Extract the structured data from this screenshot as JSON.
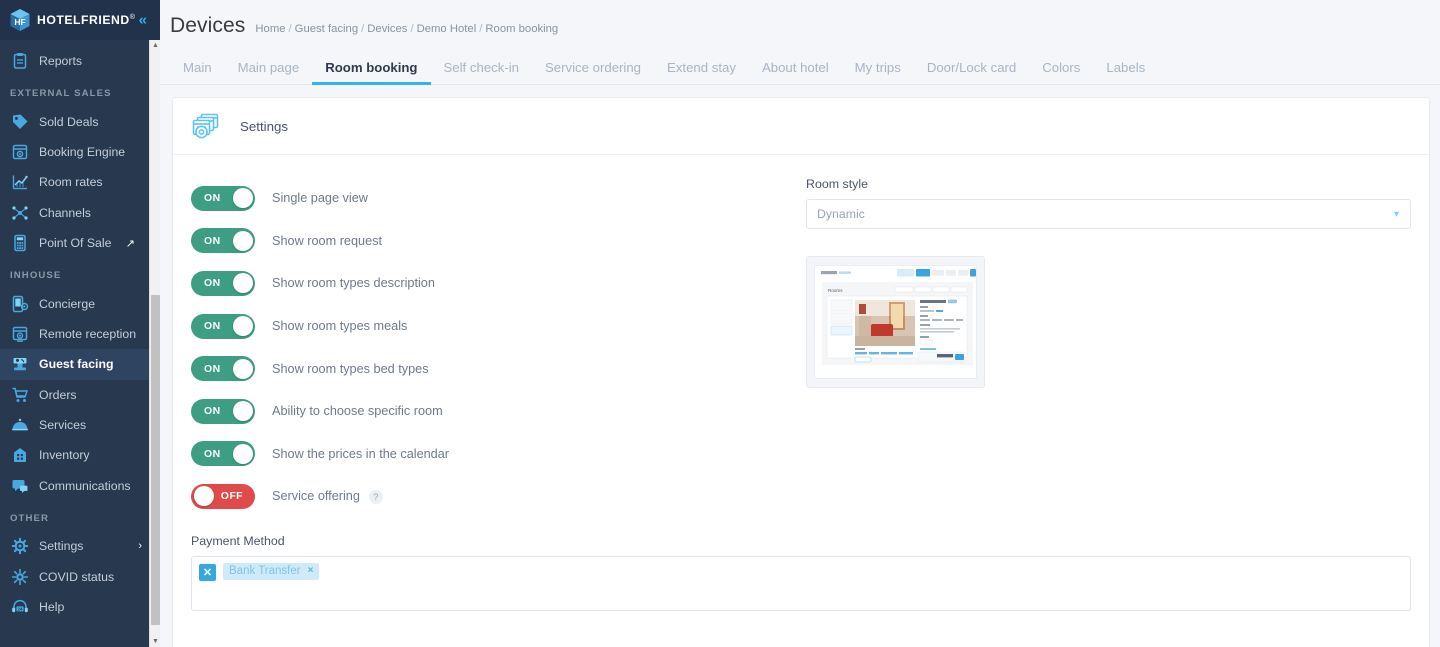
{
  "brand": {
    "logo_text": "HOTELFRIEND",
    "logo_mark": "cube-hf-logo",
    "registered_mark": "®",
    "collapse_icon": "chevron-double-left-icon"
  },
  "sidebar": {
    "items": [
      {
        "type": "item",
        "label": "Reports",
        "icon": "clipboard-icon",
        "active": false
      },
      {
        "type": "group",
        "label": "EXTERNAL SALES"
      },
      {
        "type": "item",
        "label": "Sold Deals",
        "icon": "tag-icon",
        "active": false
      },
      {
        "type": "item",
        "label": "Booking Engine",
        "icon": "window-gear-icon",
        "active": false
      },
      {
        "type": "item",
        "label": "Room rates",
        "icon": "chart-line-icon",
        "active": false
      },
      {
        "type": "item",
        "label": "Channels",
        "icon": "network-nodes-icon",
        "active": false
      },
      {
        "type": "item",
        "label": "Point Of Sale",
        "icon": "calculator-icon",
        "active": false,
        "trailing_icon": "external-link-icon"
      },
      {
        "type": "group",
        "label": "INHOUSE"
      },
      {
        "type": "item",
        "label": "Concierge",
        "icon": "phone-gear-icon",
        "active": false
      },
      {
        "type": "item",
        "label": "Remote reception",
        "icon": "monitor-gear-icon",
        "active": false
      },
      {
        "type": "item",
        "label": "Guest facing",
        "icon": "guest-podium-icon",
        "active": true
      },
      {
        "type": "item",
        "label": "Orders",
        "icon": "shopping-cart-icon",
        "active": false
      },
      {
        "type": "item",
        "label": "Services",
        "icon": "cloche-dome-icon",
        "active": false
      },
      {
        "type": "item",
        "label": "Inventory",
        "icon": "building-icon",
        "active": false
      },
      {
        "type": "item",
        "label": "Communications",
        "icon": "chat-bubbles-icon",
        "active": false
      },
      {
        "type": "group",
        "label": "OTHER"
      },
      {
        "type": "item",
        "label": "Settings",
        "icon": "gear-icon",
        "active": false,
        "trailing_icon": "chevron-right-icon"
      },
      {
        "type": "item",
        "label": "COVID status",
        "icon": "virus-icon",
        "active": false
      },
      {
        "type": "item",
        "label": "Help",
        "icon": "headset-24-icon",
        "active": false
      }
    ]
  },
  "header": {
    "title": "Devices",
    "breadcrumb": [
      "Home",
      "Guest facing",
      "Devices",
      "Demo Hotel",
      "Room booking"
    ],
    "breadcrumb_separator": "/"
  },
  "tabs": [
    {
      "label": "Main",
      "active": false
    },
    {
      "label": "Main page",
      "active": false
    },
    {
      "label": "Room booking",
      "active": true
    },
    {
      "label": "Self check-in",
      "active": false
    },
    {
      "label": "Service ordering",
      "active": false
    },
    {
      "label": "Extend stay",
      "active": false
    },
    {
      "label": "About hotel",
      "active": false
    },
    {
      "label": "My trips",
      "active": false
    },
    {
      "label": "Door/Lock card",
      "active": false
    },
    {
      "label": "Colors",
      "active": false
    },
    {
      "label": "Labels",
      "active": false
    }
  ],
  "card": {
    "title": "Settings",
    "icon": "settings-windows-gear-icon"
  },
  "settings_toggles": [
    {
      "label": "Single page view",
      "state": "ON",
      "on": true
    },
    {
      "label": "Show room request",
      "state": "ON",
      "on": true
    },
    {
      "label": "Show room types description",
      "state": "ON",
      "on": true
    },
    {
      "label": "Show room types meals",
      "state": "ON",
      "on": true
    },
    {
      "label": "Show room types bed types",
      "state": "ON",
      "on": true
    },
    {
      "label": "Ability to choose specific room",
      "state": "ON",
      "on": true
    },
    {
      "label": "Show the prices in the calendar",
      "state": "ON",
      "on": true
    },
    {
      "label": "Service offering",
      "state": "OFF",
      "on": false,
      "help": "?"
    }
  ],
  "room_style": {
    "label": "Room style",
    "value": "Dynamic",
    "chevron_icon": "chevron-down-icon",
    "preview_alt": "room-booking-page-preview"
  },
  "payment_method": {
    "label": "Payment Method",
    "clear_icon": "x-icon",
    "chips": [
      {
        "label": "Bank Transfer",
        "remove_icon": "×"
      }
    ]
  },
  "colors": {
    "sidebar_bg": "#27384f",
    "sidebar_logo_bg": "#22324a",
    "sidebar_active_bg": "#2f4461",
    "accent_blue": "#33b4f0",
    "icon_blue": "#31b0e8",
    "toggle_on": "#3d9e84",
    "toggle_off": "#e04a4a",
    "page_bg": "#f4f6f9",
    "chip_bg": "#cfeaf9"
  }
}
